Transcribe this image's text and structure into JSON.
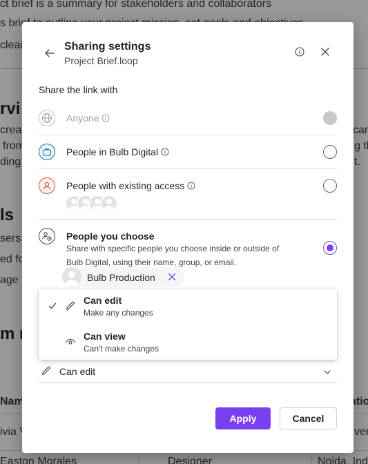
{
  "background": {
    "line1": "ct brief is a summary for stakeholders and collaborators",
    "line2": "s brief to outline your project mission, set goals and objectives",
    "line3": "clear",
    "heading1": "rvi",
    "left_lines": [
      "creat",
      "from",
      "ding"
    ],
    "right_lines": [
      "can",
      "g the",
      "t."
    ],
    "heading2": "ls",
    "left_lines2": [
      "sers",
      "ed fo",
      "age s"
    ],
    "heading3": "m m",
    "table_header_left": "Name",
    "table_header_right": "atio",
    "row1_left": "ivia V",
    "row1_right": "ver",
    "row2_left": "Easton Morales",
    "row2_mid": "Designer",
    "row2_right": "Noida, Ind"
  },
  "dialog": {
    "title": "Sharing settings",
    "subtitle": "Project Brief.loop",
    "section_label": "Share the link with",
    "options": [
      {
        "label": "Anyone",
        "state": "disabled",
        "icon": "globe-icon"
      },
      {
        "label": "People in Bulb Digital",
        "state": "unchecked",
        "icon": "briefcase-icon"
      },
      {
        "label": "People with existing access",
        "state": "unchecked",
        "icon": "person-icon"
      },
      {
        "label": "People you choose",
        "state": "checked",
        "icon": "people-settings-icon",
        "description": "Share with specific people you choose inside or outside of Bulb Digital, using their name, group, or email."
      }
    ],
    "chip_name": "Bulb Production",
    "menu": [
      {
        "label": "Can edit",
        "sub": "Make any changes",
        "selected": true,
        "icon": "pencil-icon"
      },
      {
        "label": "Can view",
        "sub": "Can't make changes",
        "selected": false,
        "icon": "eye-icon"
      }
    ],
    "permission_value": "Can edit",
    "apply_label": "Apply",
    "cancel_label": "Cancel"
  },
  "colors": {
    "accent": "#7b3ff2",
    "briefcase_icon": "#1f6f9f",
    "person_icon": "#c8542d"
  }
}
